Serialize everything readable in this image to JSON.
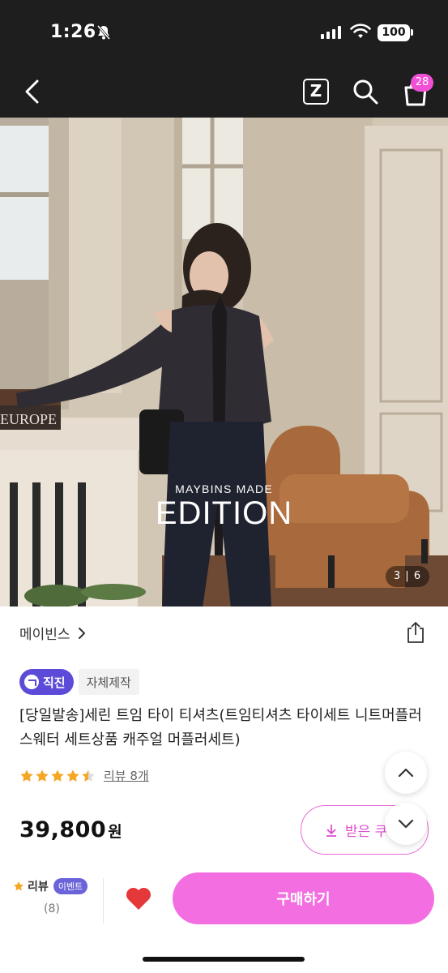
{
  "status_bar": {
    "time": "1:26",
    "battery": "100"
  },
  "header": {
    "cart_count": "28",
    "z_label": "Z"
  },
  "hero": {
    "brand_text": "MAYBINS MADE",
    "title_text": "EDITION",
    "book_text": "EUROPE",
    "page_indicator": "3 | 6"
  },
  "product": {
    "brand": "메이빈스",
    "badges": {
      "jikjin": "직진",
      "self_made": "자체제작"
    },
    "title": "[당일발송]세린 트임 타이 티셔츠(트임티셔츠 타이세트 니트머플러 스웨터 세트상품 캐주얼 머플러세트)",
    "rating": 4.5,
    "review_link": "리뷰 8개",
    "price": "39,800",
    "price_unit": "원",
    "coupon_label": "받은 쿠"
  },
  "bottom_bar": {
    "review_label": "리뷰",
    "event_label": "이벤트",
    "review_count": "(8)",
    "buy_label": "구매하기"
  },
  "colors": {
    "accent": "#f36fe1",
    "badge_purple": "#5b4bd8",
    "star": "#f5a623",
    "heart": "#e5383b"
  },
  "icons": [
    "back-icon",
    "z-icon",
    "search-icon",
    "cart-icon",
    "share-icon",
    "chevron-right-icon",
    "chevron-up-icon",
    "chevron-down-icon",
    "download-icon",
    "heart-icon",
    "star-icon",
    "bell-off-icon",
    "wifi-icon",
    "signal-icon"
  ]
}
